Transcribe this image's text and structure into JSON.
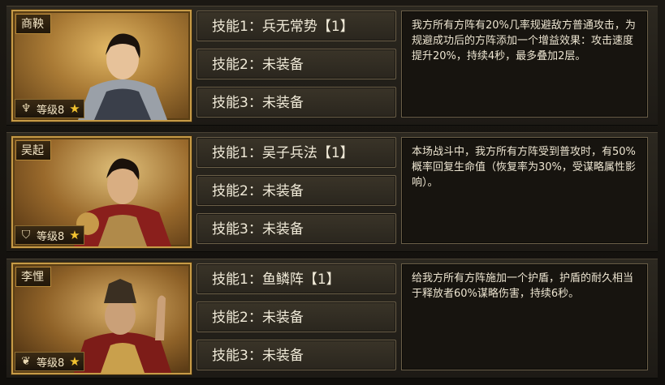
{
  "heroes": [
    {
      "name": "商鞅",
      "level": "等级8",
      "skills": [
        "技能1：兵无常势【1】",
        "技能2：未装备",
        "技能3：未装备"
      ],
      "description": "我方所有方阵有20%几率规避敌方普通攻击，为规避成功后的方阵添加一个增益效果：攻击速度提升20%，持续4秒，最多叠加2层。"
    },
    {
      "name": "吴起",
      "level": "等级8",
      "skills": [
        "技能1：吴子兵法【1】",
        "技能2：未装备",
        "技能3：未装备"
      ],
      "description": "本场战斗中，我方所有方阵受到普攻时，有50%概率回复生命值（恢复率为30%，受谋略属性影响）。"
    },
    {
      "name": "李悝",
      "level": "等级8",
      "skills": [
        "技能1：鱼鳞阵【1】",
        "技能2：未装备",
        "技能3：未装备"
      ],
      "description": "给我方所有方阵施加一个护盾，护盾的耐久相当于释放者60%谋略伤害，持续6秒。"
    }
  ],
  "icons": {
    "class": "class-emblem-icon",
    "star": "star-icon"
  },
  "colors": {
    "frame_gold": "#c79b47",
    "star": "#f2c230",
    "text": "#f0ead8"
  }
}
